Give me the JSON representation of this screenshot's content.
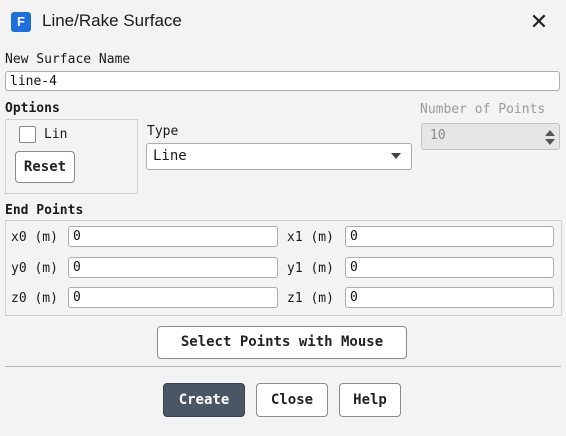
{
  "window": {
    "app_icon_letter": "F",
    "title": "Line/Rake Surface",
    "close_glyph": "✕"
  },
  "surface_name": {
    "label": "New Surface Name",
    "value": "line-4"
  },
  "options": {
    "label": "Options",
    "checkbox_label": "Lin",
    "checkbox_checked": false,
    "reset_label": "Reset"
  },
  "type": {
    "label": "Type",
    "selected": "Line"
  },
  "number_of_points": {
    "label": "Number of Points",
    "value": "10",
    "disabled": true
  },
  "end_points": {
    "label": "End Points",
    "x0": {
      "label": "x0 (m)",
      "value": "0"
    },
    "y0": {
      "label": "y0 (m)",
      "value": "0"
    },
    "z0": {
      "label": "z0 (m)",
      "value": "0"
    },
    "x1": {
      "label": "x1 (m)",
      "value": "0"
    },
    "y1": {
      "label": "y1 (m)",
      "value": "0"
    },
    "z1": {
      "label": "z1 (m)",
      "value": "0"
    }
  },
  "select_points_label": "Select Points with Mouse",
  "footer": {
    "create_label": "Create",
    "close_label": "Close",
    "help_label": "Help"
  },
  "colors": {
    "primary_button": "#4a5664",
    "app_icon": "#1e6fd9"
  }
}
